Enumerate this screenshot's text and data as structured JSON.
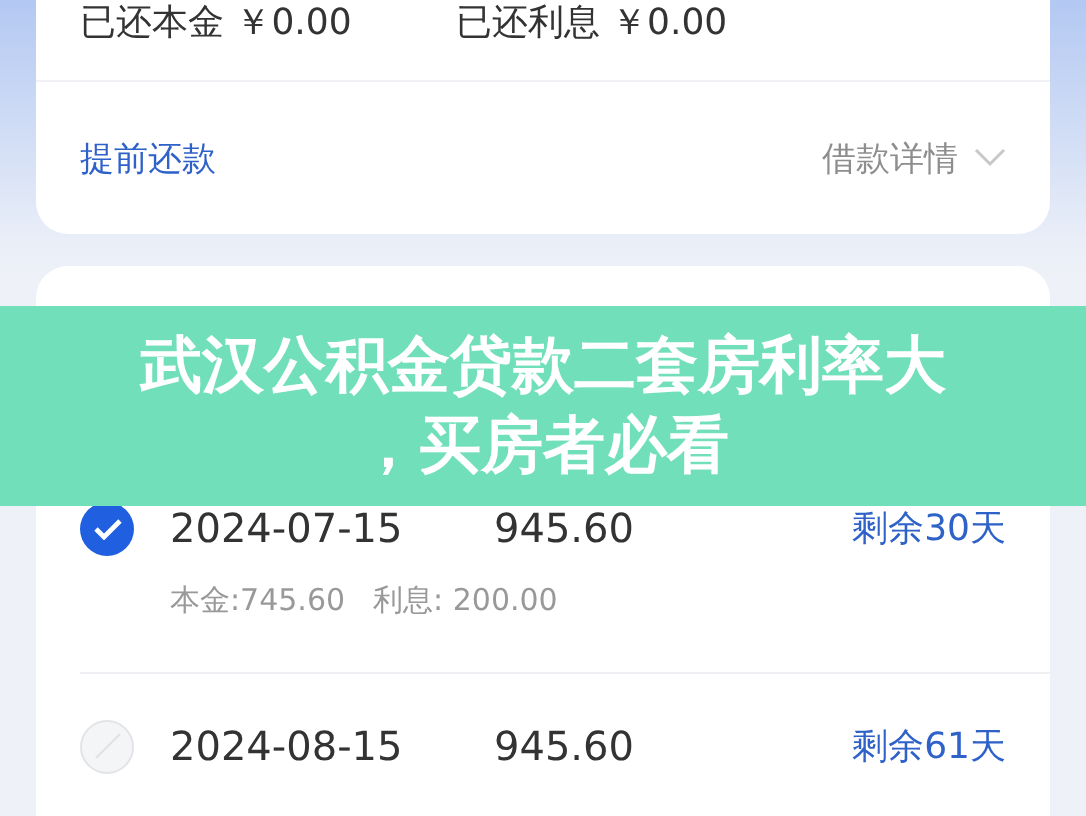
{
  "summary": [
    "已还本金 ￥0.00",
    "已还利息 ￥0.00"
  ],
  "actions": {
    "prepay": "提前还款",
    "details": "借款详情"
  },
  "schedule": {
    "rows": [
      {
        "checked": true,
        "date": "2024-07-15",
        "amount": "945.60",
        "remaining": "剩余30天",
        "breakdown": [
          "本金:745.60",
          "利息: 200.00"
        ]
      },
      {
        "checked": false,
        "date": "2024-08-15",
        "amount": "945.60",
        "remaining": "剩余61天"
      }
    ]
  },
  "banner": {
    "lines": [
      "武汉公积金贷款二套房利率大",
      "，买房者必看"
    ]
  }
}
